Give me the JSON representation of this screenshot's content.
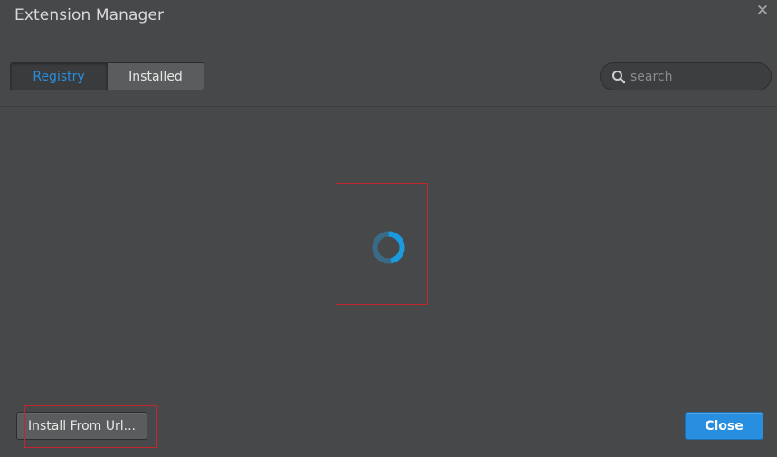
{
  "dialog": {
    "title": "Extension Manager",
    "close_symbol": "✕"
  },
  "tabs": [
    {
      "label": "Registry",
      "active": true
    },
    {
      "label": "Installed",
      "active": false
    }
  ],
  "search": {
    "placeholder": "search",
    "value": "",
    "icon": "search-icon"
  },
  "content": {
    "state": "loading",
    "icon": "spinner-icon"
  },
  "footer": {
    "install_label": "Install From Url...",
    "close_label": "Close"
  },
  "colors": {
    "background": "#47484a",
    "accent": "#288edf",
    "highlight_outline": "#c4262e"
  }
}
